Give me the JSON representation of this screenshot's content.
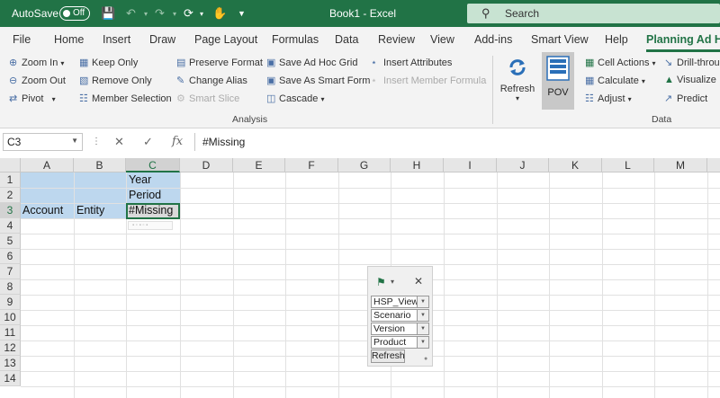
{
  "titlebar": {
    "autosave_label": "AutoSave",
    "autosave_state": "Off",
    "title": "Book1  -  Excel",
    "search_placeholder": "Search"
  },
  "tabs": [
    "File",
    "Home",
    "Insert",
    "Draw",
    "Page Layout",
    "Formulas",
    "Data",
    "Review",
    "View",
    "Add-ins",
    "Smart View",
    "Help",
    "Planning Ad Ho"
  ],
  "ribbon": {
    "analysis": {
      "zoom_in": "Zoom In",
      "zoom_out": "Zoom Out",
      "pivot": "Pivot",
      "keep_only": "Keep Only",
      "remove_only": "Remove Only",
      "member_selection": "Member Selection",
      "preserve_format": "Preserve Format",
      "change_alias": "Change Alias",
      "smart_slice": "Smart Slice",
      "save_ad_hoc_grid": "Save Ad Hoc Grid",
      "save_as_smart_form": "Save As Smart Form",
      "cascade": "Cascade",
      "insert_attributes": "Insert Attributes",
      "insert_member_formula": "Insert Member Formula",
      "group_label": "Analysis"
    },
    "data": {
      "refresh": "Refresh",
      "pov": "POV",
      "cell_actions": "Cell Actions",
      "calculate": "Calculate",
      "adjust": "Adjust",
      "drill_through": "Drill-throu",
      "visualize": "Visualize",
      "predict": "Predict",
      "group_label": "Data"
    }
  },
  "formula_bar": {
    "name_box": "C3",
    "formula": "#Missing"
  },
  "grid": {
    "columns": [
      "A",
      "B",
      "C",
      "D",
      "E",
      "F",
      "G",
      "H",
      "I",
      "J",
      "K",
      "L",
      "M"
    ],
    "rows": [
      "1",
      "2",
      "3",
      "4",
      "5",
      "6",
      "7",
      "8",
      "9",
      "10",
      "11",
      "12",
      "13",
      "14"
    ],
    "cells": {
      "C1": "Year",
      "C2": "Period",
      "A3": "Account",
      "B3": "Entity",
      "C3": "#Missing"
    }
  },
  "pov_panel": {
    "members": [
      "HSP_View",
      "Scenario",
      "Version",
      "Product"
    ],
    "refresh": "Refresh"
  },
  "colors": {
    "excel_green": "#217346",
    "selection_blue": "#bdd7ee"
  }
}
